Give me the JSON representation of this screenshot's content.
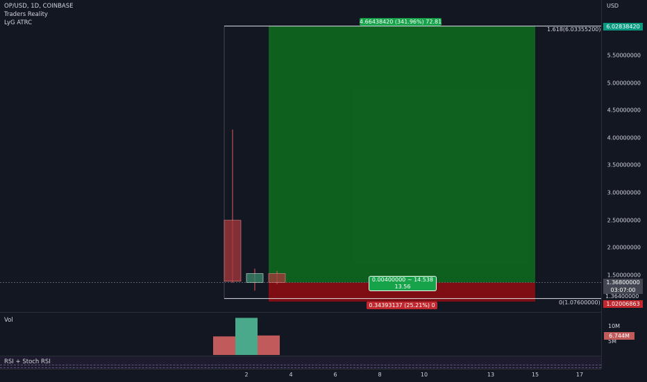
{
  "legend": {
    "symbol": "OP/USD, 1D, COINBASE",
    "indicator1": "Traders Reality",
    "indicator2": "LyG ATRC"
  },
  "price_axis": {
    "currency": "USD",
    "ticks": [
      "5.50000000",
      "5.00000000",
      "4.50000000",
      "4.00000000",
      "3.50000000",
      "3.00000000",
      "2.50000000",
      "2.00000000",
      "1.50000000"
    ],
    "tick_values": [
      5.5,
      5.0,
      4.5,
      4.0,
      3.5,
      3.0,
      2.5,
      2.0,
      1.5
    ],
    "range": [
      1.0,
      6.35
    ],
    "current_price": "1.36800000",
    "countdown": "03:07:00",
    "level_1364": "1.36400000",
    "tp_price": "6.02838420",
    "sl_price": "1.02006863",
    "colors": {
      "green": "#089981",
      "red": "#c1272d",
      "grey": "#434651"
    }
  },
  "fib": {
    "upper_label": "1.618(6.03355200)",
    "lower_label": "0(1.07600000)",
    "upper_value": 6.033552,
    "lower_value": 1.076
  },
  "position": {
    "profit_label": "4.66438420 (341.96%) 72.81",
    "entry_label_line1": "0.00400000 ~ 14.538",
    "entry_label_line2": "13.56",
    "loss_label": "0.34393137 (25.21%) 0",
    "entry_value": 1.368,
    "tp_value": 6.0283842,
    "sl_value": 1.02006863
  },
  "candles": [
    {
      "bar": 0,
      "open": 2.5,
      "high": 4.15,
      "low": 1.36,
      "close": 1.39,
      "dir": "down"
    },
    {
      "bar": 1,
      "open": 1.37,
      "high": 1.62,
      "low": 1.22,
      "close": 1.53,
      "dir": "up"
    },
    {
      "bar": 2,
      "open": 1.53,
      "high": 1.58,
      "low": 1.34,
      "close": 1.37,
      "dir": "down"
    }
  ],
  "volume": {
    "label": "Vol",
    "ticks": [
      "10M",
      "5M"
    ],
    "current": "6.744M",
    "bars": [
      {
        "bar": 0,
        "value": 6.0,
        "dir": "down"
      },
      {
        "bar": 1,
        "value": 12.0,
        "dir": "up"
      },
      {
        "bar": 2,
        "value": 6.3,
        "dir": "down"
      }
    ],
    "max": 13
  },
  "rsi": {
    "label": "RSI + Stoch RSI"
  },
  "time_axis": {
    "labels": [
      "2",
      "4",
      "6",
      "8",
      "10",
      "13",
      "15",
      "17"
    ]
  }
}
